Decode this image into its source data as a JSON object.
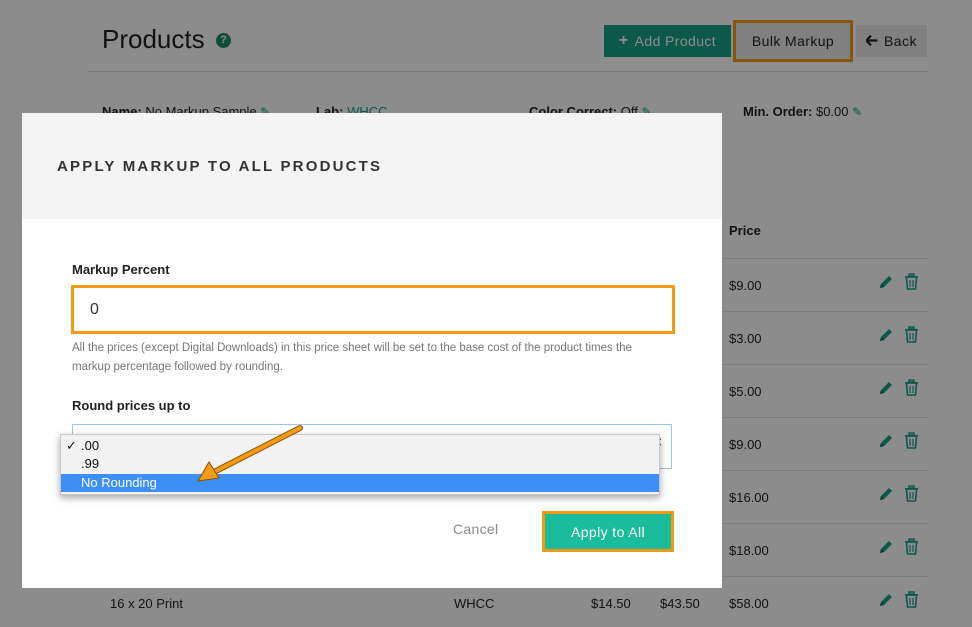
{
  "header": {
    "title": "Products",
    "help_glyph": "?",
    "add_product_label": "Add Product",
    "bulk_markup_label": "Bulk Markup",
    "back_label": "Back"
  },
  "meta": {
    "name_label": "Name:",
    "name_value": "No Markup Sample",
    "lab_label": "Lab:",
    "lab_value": "WHCC",
    "color_label": "Color Correct:",
    "color_value": "Off",
    "min_order_label": "Min. Order:",
    "min_order_value": "$0.00"
  },
  "table": {
    "price_header": "Price",
    "rows": [
      {
        "price": "$9.00"
      },
      {
        "price": "$3.00"
      },
      {
        "price": "$5.00"
      },
      {
        "price": "$9.00"
      },
      {
        "price": "$16.00"
      },
      {
        "price": "$18.00"
      },
      {
        "name": "16 x 20 Print",
        "lab": "WHCC",
        "cost": "$14.50",
        "markup": "$43.50",
        "price": "$58.00"
      }
    ]
  },
  "modal": {
    "title": "APPLY MARKUP TO ALL PRODUCTS",
    "markup_label": "Markup Percent",
    "markup_value": "0",
    "help_text": "All the prices (except Digital Downloads) in this price sheet will be set to the base cost of the product times the markup percentage followed by rounding.",
    "round_label": "Round prices up to",
    "round_options": [
      ".00",
      ".99",
      "No Rounding"
    ],
    "checked_mark": "✓",
    "cancel_label": "Cancel",
    "apply_label": "Apply to All"
  },
  "colors": {
    "accent": "#16a085",
    "highlight": "#f39c12",
    "apply_button": "#1bbc9b",
    "option_highlight": "#3d8ff5"
  }
}
